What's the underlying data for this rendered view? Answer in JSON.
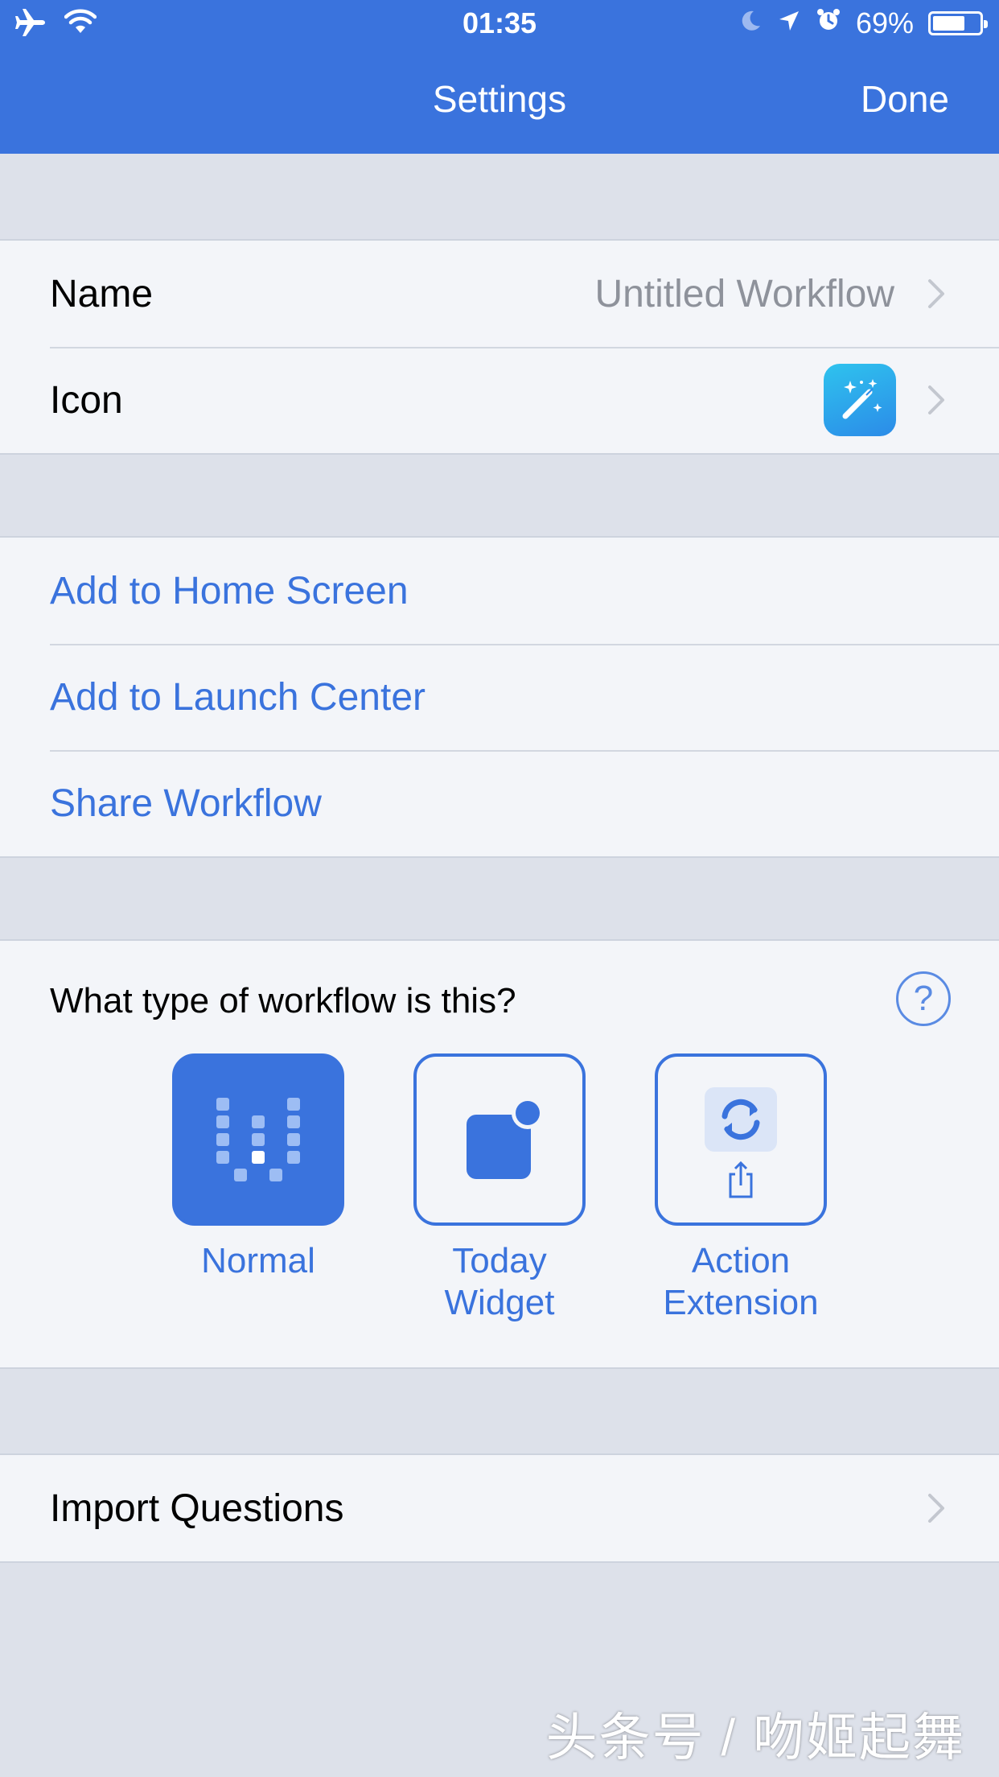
{
  "status_bar": {
    "time": "01:35",
    "battery_percent": "69%",
    "battery_level": 0.69,
    "icons": [
      "airplane-icon",
      "wifi-icon",
      "moon-icon",
      "location-icon",
      "alarm-icon",
      "battery-icon"
    ]
  },
  "nav": {
    "title": "Settings",
    "done_label": "Done"
  },
  "general": {
    "name_label": "Name",
    "name_value": "Untitled Workflow",
    "icon_label": "Icon",
    "icon_tile_color": "#2b9fe9"
  },
  "actions": {
    "items": [
      {
        "label": "Add to Home Screen"
      },
      {
        "label": "Add to Launch Center"
      },
      {
        "label": "Share Workflow"
      }
    ]
  },
  "workflow_type": {
    "question": "What type of workflow is this?",
    "help_label": "?",
    "options": [
      {
        "line1": "Normal",
        "line2": "",
        "selected": true
      },
      {
        "line1": "Today",
        "line2": "Widget",
        "selected": false
      },
      {
        "line1": "Action",
        "line2": "Extension",
        "selected": false
      }
    ]
  },
  "import": {
    "label": "Import Questions"
  },
  "watermark": "头条号 / 吻姬起舞",
  "colors": {
    "accent": "#3a73dd",
    "background": "#dde1ea",
    "cell": "#f3f5f9"
  }
}
